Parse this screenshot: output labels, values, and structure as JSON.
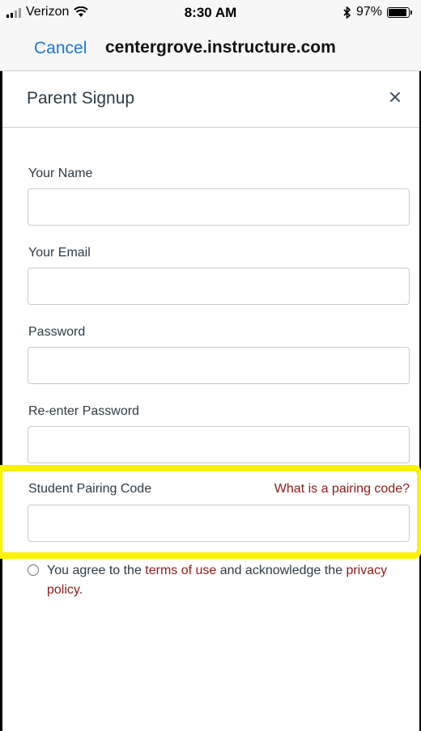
{
  "status_bar": {
    "carrier": "Verizon",
    "time": "8:30 AM",
    "battery_percent": "97%"
  },
  "nav": {
    "cancel_label": "Cancel",
    "domain": "centergrove.instructure.com"
  },
  "modal": {
    "title": "Parent Signup",
    "close_icon": "close-icon"
  },
  "form": {
    "name_label": "Your Name",
    "name_value": "",
    "email_label": "Your Email",
    "email_value": "",
    "password_label": "Password",
    "password_value": "",
    "reenter_label": "Re-enter Password",
    "reenter_value": "",
    "pairing_label": "Student Pairing Code",
    "pairing_help_link": "What is a pairing code?",
    "pairing_value": "",
    "agree_prefix": "You agree to the ",
    "terms_link": "terms of use",
    "agree_middle": " and acknowledge the ",
    "privacy_link": "privacy policy",
    "agree_suffix": "."
  },
  "colors": {
    "link_blue": "#1778d3",
    "link_red": "#8b1a1a",
    "highlight": "#fff200",
    "text": "#2d3b45"
  }
}
